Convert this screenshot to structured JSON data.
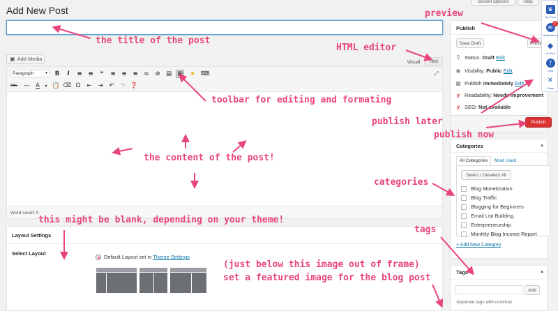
{
  "page": {
    "title": "Add New Post"
  },
  "header": {
    "screen_options": "Screen Options",
    "help": "Help"
  },
  "post": {
    "title_value": "",
    "add_media": "Add Media"
  },
  "editor": {
    "tab_visual": "Visual",
    "tab_text": "Text",
    "format_select": "Paragraph",
    "word_count": "Word count: 0"
  },
  "layout": {
    "section_title": "Layout Settings",
    "select_label": "Select Layout",
    "default_text": "Default Layout set in",
    "theme_link": "Theme Settings"
  },
  "publish": {
    "title": "Publish",
    "save_draft": "Save Draft",
    "preview": "Preview",
    "status_label": "Status:",
    "status_value": "Draft",
    "visibility_label": "Visibility:",
    "visibility_value": "Public",
    "publish_label": "Publish",
    "publish_value": "immediately",
    "edit": "Edit",
    "readability_label": "Readability:",
    "readability_value": "Needs improvement",
    "seo_label": "SEO:",
    "seo_value": "Not available",
    "publish_button": "Publish"
  },
  "categories": {
    "title": "Categories",
    "tab_all": "All Categories",
    "tab_most": "Most Used",
    "select_toggle": "Select / Deselect All",
    "items": [
      "Blog Monetization",
      "Blog Traffic",
      "Blogging for Beginners",
      "Email List Building",
      "Entrepreneurship",
      "Monthly Blog Income Report"
    ],
    "add_new": "+ Add New Category"
  },
  "tags": {
    "title": "Tags",
    "add_button": "Add",
    "hint": "Separate tags with commas"
  },
  "side_toolbar": {
    "items": [
      {
        "label": "My Tools",
        "icon": "crown-icon"
      },
      {
        "label": "Notifications",
        "icon": "bell-icon",
        "badge": "2"
      },
      {
        "label": "Go Pro!",
        "icon": "diamond-icon"
      },
      {
        "label": "Help",
        "icon": "help-icon"
      },
      {
        "label": "Close",
        "icon": "close-icon"
      }
    ]
  },
  "annotations": {
    "title": "the title of the post",
    "html_editor": "HTML editor",
    "preview": "preview",
    "toolbar": "toolbar for editing and formating",
    "publish_later": "publish later",
    "publish_now": "publish now",
    "content": "the content of the post!",
    "categories": "categories",
    "blank": "this might be blank, depending on your theme!",
    "tags": "tags",
    "featured_1": "(just below this image out of frame)",
    "featured_2": "set a featured image for the blog post"
  },
  "colors": {
    "accent": "#e8457a",
    "primary": "#0073aa",
    "publish_btn": "#dc3232",
    "side": "#2b5cb8"
  }
}
